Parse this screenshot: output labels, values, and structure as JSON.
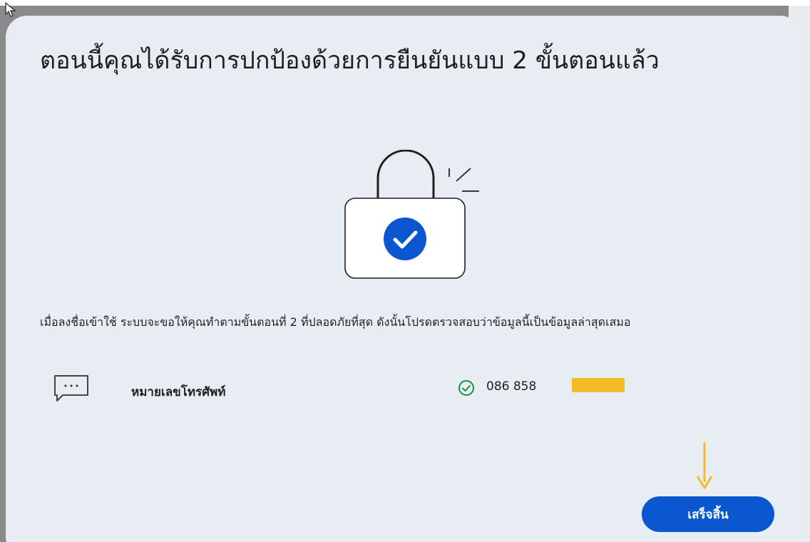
{
  "dialog": {
    "title": "ตอนนี้คุณได้รับการปกป้องด้วยการยืนยันแบบ 2 ขั้นตอนแล้ว",
    "description": "เมื่อลงชื่อเข้าใช้ ระบบจะขอให้คุณทำตามขั้นตอนที่ 2 ที่ปลอดภัยที่สุด ดังนั้นโปรดตรวจสอบว่าข้อมูลนี้เป็นข้อมูลล่าสุดเสมอ",
    "method": {
      "label": "หมายเลขโทรศัพท์",
      "phone": "086 858",
      "icon": "sms-icon",
      "status_icon": "check-circle-icon"
    },
    "done_button": "เสร็จสิ้น"
  },
  "colors": {
    "accent": "#0b57d0",
    "check": "#1e8e3e",
    "redaction": "#f4bb28",
    "arrow": "#f4bb28",
    "dialog_bg": "#e8edf3"
  }
}
